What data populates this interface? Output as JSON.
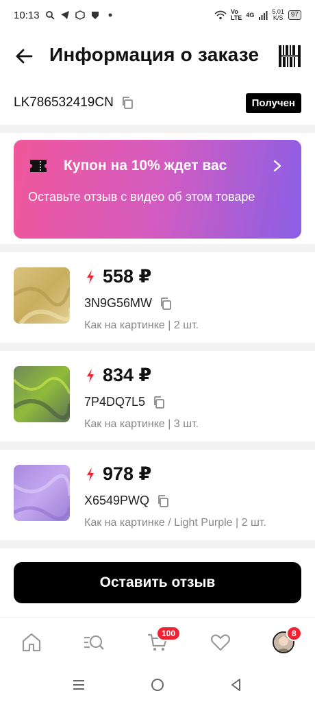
{
  "status_bar": {
    "time": "10:13",
    "net_type": "Vo\nLTE",
    "signal": "4G",
    "speed": "5,01\nK/S",
    "battery": "97"
  },
  "header": {
    "title": "Информация о заказе"
  },
  "order": {
    "tracking_number": "LK786532419CN",
    "status": "Получен"
  },
  "coupon": {
    "title": "Купон на 10% ждет вас",
    "text": "Оставьте отзыв с видео об этом товаре"
  },
  "products": [
    {
      "price": "558 ₽",
      "sku": "3N9G56MW",
      "variant": "Как на картинке | 2 шт."
    },
    {
      "price": "834 ₽",
      "sku": "7P4DQ7L5",
      "variant": "Как на картинке | 3 шт."
    },
    {
      "price": "978 ₽",
      "sku": "X6549PWQ",
      "variant": "Как на картинке / Light Purple | 2 шт."
    }
  ],
  "review_button": {
    "label": "Оставить отзыв"
  },
  "bottom_nav": {
    "cart_badge": "100",
    "profile_badge": "8"
  },
  "colors": {
    "accent_red": "#ee2233",
    "coupon_start": "#f0579a",
    "coupon_end": "#8a5fe6"
  }
}
